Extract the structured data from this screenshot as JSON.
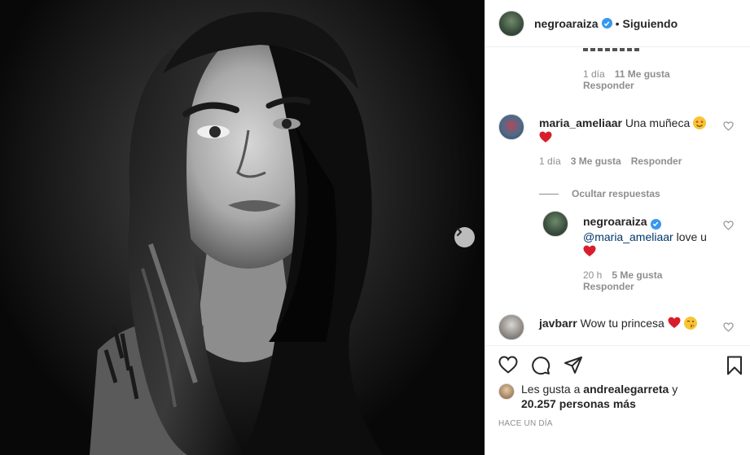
{
  "post_header": {
    "username": "negroaraiza",
    "separator": "•",
    "follow_status": "Siguiendo"
  },
  "comments": {
    "truncated_reply": {
      "time": "1 día",
      "likes": "11 Me gusta",
      "reply": "Responder"
    },
    "maria": {
      "username": "maria_ameliaar",
      "text": "Una muñeca",
      "time": "1 día",
      "likes": "3 Me gusta",
      "reply": "Responder",
      "hide_replies": "Ocultar respuestas"
    },
    "reply_negro": {
      "username": "negroaraiza",
      "mention": "@maria_ameliaar",
      "text": " love u",
      "time": "20 h",
      "likes": "5 Me gusta",
      "reply": "Responder"
    },
    "javbarr": {
      "username": "javbarr",
      "text": "Wow tu princesa"
    }
  },
  "likes": {
    "prefix": "Les gusta a",
    "user": "andrealegarreta",
    "joiner": " y",
    "count": "20.257",
    "suffix": " personas más"
  },
  "timestamp": "HACE UN DÍA",
  "colors": {
    "text": "#262626",
    "secondary": "#8e8e8e",
    "verified": "#3897f0",
    "heart": "#ed4956",
    "mention": "#00376b"
  },
  "icons": [
    "verified-badge-icon",
    "heart-icon",
    "comment-icon",
    "share-icon",
    "bookmark-icon",
    "chevron-right-icon"
  ]
}
